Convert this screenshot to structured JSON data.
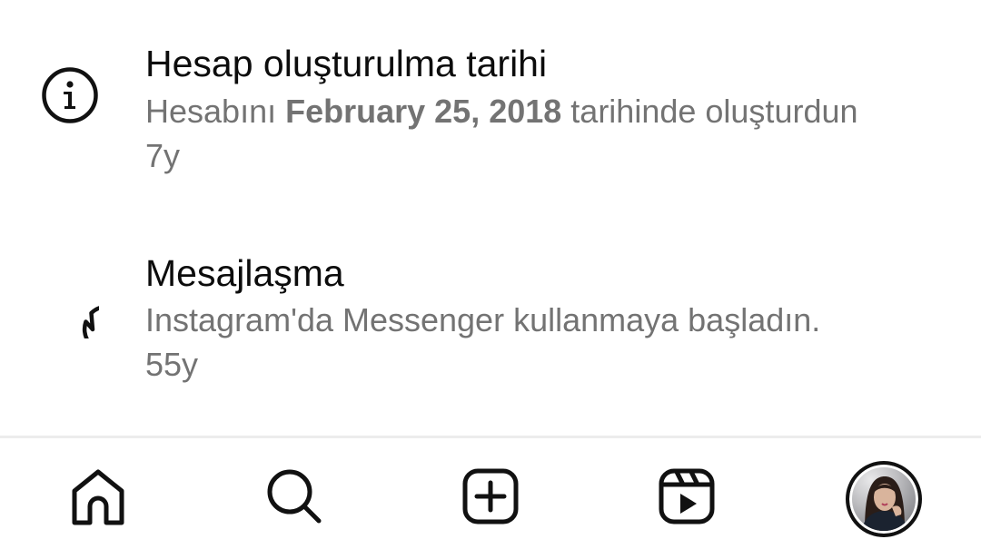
{
  "rows": [
    {
      "icon": "info-icon",
      "title": "Hesap oluşturulma tarihi",
      "desc_prefix": "Hesabını ",
      "desc_bold": "February 25, 2018",
      "desc_suffix": " tarihinde oluşturdun",
      "time": "7y"
    },
    {
      "icon": "message-bubble-icon",
      "title": "Mesajlaşma",
      "desc": "Instagram'da Messenger kullanmaya başladın.",
      "time": "55y"
    }
  ],
  "nav": {
    "items": [
      "home-icon",
      "search-icon",
      "create-icon",
      "reels-icon",
      "profile-avatar"
    ]
  },
  "colors": {
    "title": "#0c0c0c",
    "secondary": "#737373",
    "divider": "#ececec",
    "icon": "#111111"
  }
}
